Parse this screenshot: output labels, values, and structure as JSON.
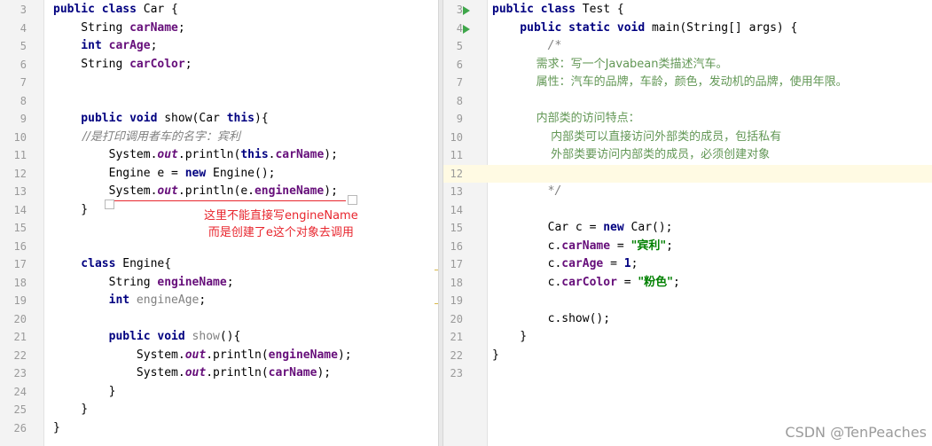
{
  "left_editor": {
    "lines": [
      {
        "n": "3",
        "t": [
          [
            "kw",
            "public class "
          ],
          [
            "",
            "Car {"
          ]
        ]
      },
      {
        "n": "4",
        "t": [
          [
            "",
            "    String "
          ],
          [
            "fld",
            "carName"
          ],
          [
            "",
            ";"
          ]
        ]
      },
      {
        "n": "5",
        "t": [
          [
            "kw",
            "    int "
          ],
          [
            "fld",
            "carAge"
          ],
          [
            "",
            ";"
          ]
        ]
      },
      {
        "n": "6",
        "t": [
          [
            "",
            "    String "
          ],
          [
            "fld",
            "carColor"
          ],
          [
            "",
            ";"
          ]
        ]
      },
      {
        "n": "7",
        "t": []
      },
      {
        "n": "8",
        "t": []
      },
      {
        "n": "9",
        "t": [
          [
            "kw",
            "    public void "
          ],
          [
            "",
            "show(Car "
          ],
          [
            "kw",
            "this"
          ],
          [
            "",
            "){"
          ]
        ]
      },
      {
        "n": "10",
        "t": [
          [
            "cmt",
            "        //是打印调用者车的名字：宾利"
          ]
        ]
      },
      {
        "n": "11",
        "t": [
          [
            "",
            "        System."
          ],
          [
            "ital",
            "out"
          ],
          [
            "",
            ".println("
          ],
          [
            "kw",
            "this"
          ],
          [
            "",
            "."
          ],
          [
            "fld",
            "carName"
          ],
          [
            "",
            ");"
          ]
        ]
      },
      {
        "n": "12",
        "t": [
          [
            "",
            "        Engine e = "
          ],
          [
            "kw",
            "new "
          ],
          [
            "",
            "Engine();"
          ]
        ]
      },
      {
        "n": "13",
        "t": [
          [
            "",
            "        System."
          ],
          [
            "ital",
            "out"
          ],
          [
            "",
            ".println(e."
          ],
          [
            "fld",
            "engineName"
          ],
          [
            "",
            ");"
          ]
        ]
      },
      {
        "n": "14",
        "t": [
          [
            "",
            "    }"
          ]
        ]
      },
      {
        "n": "15",
        "t": []
      },
      {
        "n": "16",
        "t": []
      },
      {
        "n": "17",
        "t": [
          [
            "kw",
            "    class "
          ],
          [
            "",
            "Engine{"
          ]
        ]
      },
      {
        "n": "18",
        "t": [
          [
            "",
            "        String "
          ],
          [
            "fld",
            "engineName"
          ],
          [
            "",
            ";"
          ]
        ]
      },
      {
        "n": "19",
        "t": [
          [
            "kw",
            "        int "
          ],
          [
            "greyfld",
            "engineAge"
          ],
          [
            "",
            ";"
          ]
        ]
      },
      {
        "n": "20",
        "t": []
      },
      {
        "n": "21",
        "t": [
          [
            "kw",
            "        public void "
          ],
          [
            "greyfld",
            "show"
          ],
          [
            "",
            "(){"
          ]
        ]
      },
      {
        "n": "22",
        "t": [
          [
            "",
            "            System."
          ],
          [
            "ital",
            "out"
          ],
          [
            "",
            ".println("
          ],
          [
            "fld",
            "engineName"
          ],
          [
            "",
            ");"
          ]
        ]
      },
      {
        "n": "23",
        "t": [
          [
            "",
            "            System."
          ],
          [
            "ital",
            "out"
          ],
          [
            "",
            ".println("
          ],
          [
            "fld",
            "carName"
          ],
          [
            "",
            ");"
          ]
        ]
      },
      {
        "n": "24",
        "t": [
          [
            "",
            "        }"
          ]
        ]
      },
      {
        "n": "25",
        "t": [
          [
            "",
            "    }"
          ]
        ]
      },
      {
        "n": "26",
        "t": [
          [
            "",
            "}"
          ]
        ]
      }
    ],
    "annotation_line1": "这里不能直接写engineName",
    "annotation_line2": "而是创建了e这个对象去调用"
  },
  "right_editor": {
    "lines": [
      {
        "n": "3",
        "run": true,
        "t": [
          [
            "kw",
            "public class "
          ],
          [
            "",
            "Test {"
          ]
        ]
      },
      {
        "n": "4",
        "run": true,
        "t": [
          [
            "kw",
            "    public static void "
          ],
          [
            "",
            "main(String[] args) {"
          ]
        ]
      },
      {
        "n": "5",
        "t": [
          [
            "cmt",
            "        /*"
          ]
        ]
      },
      {
        "n": "6",
        "t": [
          [
            "dcmt",
            "            需求：写一个Javabean类描述汽车。"
          ]
        ]
      },
      {
        "n": "7",
        "t": [
          [
            "dcmt",
            "            属性：汽车的品牌，车龄，颜色，发动机的品牌，使用年限。"
          ]
        ]
      },
      {
        "n": "8",
        "t": []
      },
      {
        "n": "9",
        "t": [
          [
            "dcmt",
            "            内部类的访问特点："
          ]
        ]
      },
      {
        "n": "10",
        "t": [
          [
            "dcmt",
            "                内部类可以直接访问外部类的成员，包括私有"
          ]
        ]
      },
      {
        "n": "11",
        "t": [
          [
            "dcmt",
            "                外部类要访问内部类的成员，必须创建对象"
          ]
        ]
      },
      {
        "n": "12",
        "cur": true,
        "t": []
      },
      {
        "n": "13",
        "t": [
          [
            "cmt",
            "        */"
          ]
        ]
      },
      {
        "n": "14",
        "t": []
      },
      {
        "n": "15",
        "t": [
          [
            "",
            "        Car c = "
          ],
          [
            "kw",
            "new "
          ],
          [
            "",
            "Car();"
          ]
        ]
      },
      {
        "n": "16",
        "t": [
          [
            "",
            "        c."
          ],
          [
            "fld",
            "carName"
          ],
          [
            "",
            " = "
          ],
          [
            "str",
            "\"宾利\""
          ],
          [
            "",
            ";"
          ]
        ]
      },
      {
        "n": "17",
        "t": [
          [
            "",
            "        c."
          ],
          [
            "fld",
            "carAge"
          ],
          [
            "",
            " = "
          ],
          [
            "kw",
            "1"
          ],
          [
            "",
            ";"
          ]
        ]
      },
      {
        "n": "18",
        "t": [
          [
            "",
            "        c."
          ],
          [
            "fld",
            "carColor"
          ],
          [
            "",
            " = "
          ],
          [
            "str",
            "\"粉色\""
          ],
          [
            "",
            ";"
          ]
        ]
      },
      {
        "n": "19",
        "t": []
      },
      {
        "n": "20",
        "t": [
          [
            "",
            "        c.show();"
          ]
        ]
      },
      {
        "n": "21",
        "t": [
          [
            "",
            "    }"
          ]
        ]
      },
      {
        "n": "22",
        "t": [
          [
            "",
            "}"
          ]
        ]
      },
      {
        "n": "23",
        "t": []
      }
    ]
  },
  "watermark": "CSDN @TenPeaches",
  "colors": {
    "keyword": "#000080",
    "field": "#660e7a",
    "string": "#008000",
    "comment": "#808080",
    "annotation": "#e8262e"
  }
}
